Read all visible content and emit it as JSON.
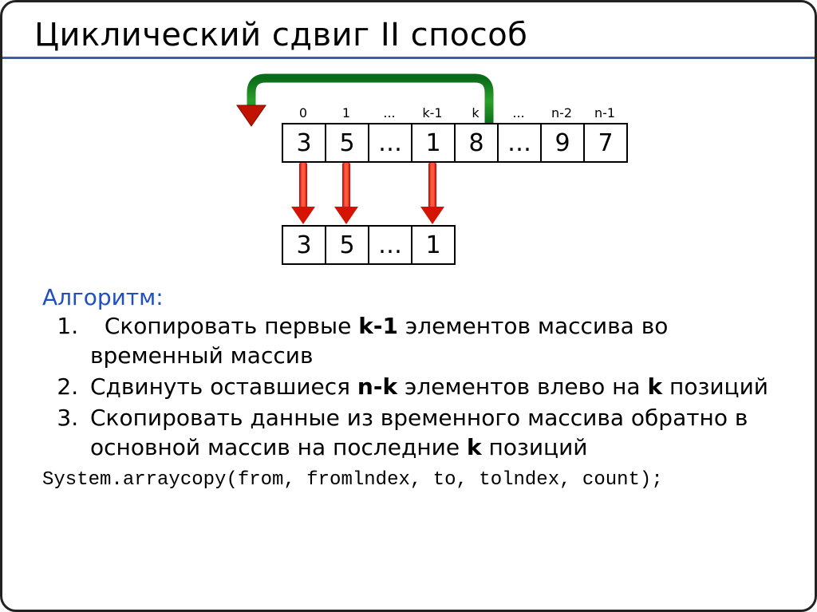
{
  "title": "Циклический сдвиг II способ",
  "indices": [
    "0",
    "1",
    "...",
    "k-1",
    "k",
    "...",
    "n-2",
    "n-1"
  ],
  "array1": [
    "3",
    "5",
    "…",
    "1",
    "8",
    "…",
    "9",
    "7"
  ],
  "array2": [
    "3",
    "5",
    "…",
    "1"
  ],
  "algo_label": "Алгоритм:",
  "steps": {
    "s1a": "Скопировать первые ",
    "s1b": "k-1",
    "s1c": " элементов массива во временный массив",
    "s2a": "Сдвинуть оставшиеся ",
    "s2b": "n-k",
    "s2c": " элементов влево на ",
    "s2d": "k",
    "s2e": " позиций",
    "s3a": "Скопировать данные из временного массива обратно в основной массив на последние ",
    "s3b": "k",
    "s3c": " позиций"
  },
  "code": "System.arraycopy(from, fromlndex, to, tolndex, count);"
}
